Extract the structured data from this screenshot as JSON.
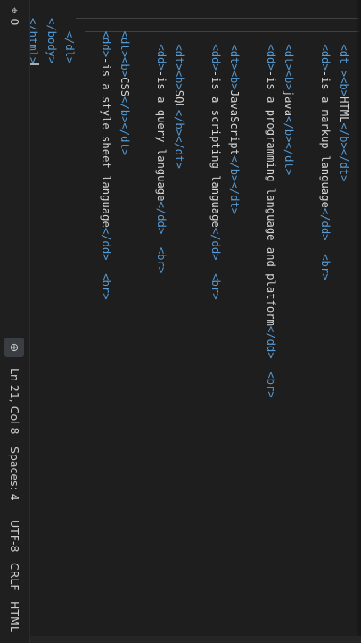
{
  "editor": {
    "lines": [
      [
        [
          "text",
          "    "
        ],
        [
          "tag",
          "<dt "
        ],
        [
          "tag",
          ">"
        ],
        [
          "tag",
          "<b>"
        ],
        [
          "text",
          "HTML"
        ],
        [
          "tag",
          "</b>"
        ],
        [
          "tag",
          "</dt>"
        ]
      ],
      [
        [
          "text",
          "    "
        ],
        [
          "tag",
          "<dd>"
        ],
        [
          "text",
          "-is a markup language"
        ],
        [
          "tag",
          "</dd>"
        ],
        [
          "text",
          "  "
        ],
        [
          "tag",
          "<br>"
        ]
      ],
      [
        [
          "text",
          ""
        ]
      ],
      [
        [
          "text",
          "    "
        ],
        [
          "tag",
          "<dt>"
        ],
        [
          "tag",
          "<b>"
        ],
        [
          "text",
          "java"
        ],
        [
          "tag",
          "</b>"
        ],
        [
          "tag",
          "</dt>"
        ]
      ],
      [
        [
          "text",
          "    "
        ],
        [
          "tag",
          "<dd>"
        ],
        [
          "text",
          "-is a programming language and platform"
        ],
        [
          "tag",
          "</dd>"
        ],
        [
          "text",
          "  "
        ],
        [
          "tag",
          "<br>"
        ]
      ],
      [
        [
          "text",
          ""
        ]
      ],
      [
        [
          "text",
          "    "
        ],
        [
          "tag",
          "<dt>"
        ],
        [
          "tag",
          "<b>"
        ],
        [
          "text",
          "JavaScript"
        ],
        [
          "tag",
          "</b>"
        ],
        [
          "tag",
          "</dt>"
        ]
      ],
      [
        [
          "text",
          "    "
        ],
        [
          "tag",
          "<dd>"
        ],
        [
          "text",
          "-is a scripting language"
        ],
        [
          "tag",
          "</dd>"
        ],
        [
          "text",
          "  "
        ],
        [
          "tag",
          "<br>"
        ]
      ],
      [
        [
          "text",
          ""
        ]
      ],
      [
        [
          "text",
          "    "
        ],
        [
          "tag",
          "<dt>"
        ],
        [
          "tag",
          "<b>"
        ],
        [
          "text",
          "SQL"
        ],
        [
          "tag",
          "</b>"
        ],
        [
          "tag",
          "</dt>"
        ]
      ],
      [
        [
          "text",
          "    "
        ],
        [
          "tag",
          "<dd>"
        ],
        [
          "text",
          "-is a query language"
        ],
        [
          "tag",
          "</dd>"
        ],
        [
          "text",
          "  "
        ],
        [
          "tag",
          "<br>"
        ]
      ],
      [
        [
          "text",
          ""
        ]
      ],
      [
        [
          "text",
          "  "
        ],
        [
          "tag",
          "<dt>"
        ],
        [
          "tag",
          "<b>"
        ],
        [
          "text",
          "CSS"
        ],
        [
          "tag",
          "</b>"
        ],
        [
          "tag",
          "</dt>"
        ]
      ],
      [
        [
          "text",
          "  "
        ],
        [
          "tag",
          "<dd>"
        ],
        [
          "text",
          "-is a style sheet language"
        ],
        [
          "tag",
          "</dd>"
        ],
        [
          "text",
          "  "
        ],
        [
          "tag",
          "<br>"
        ]
      ],
      [
        [
          "text",
          ""
        ]
      ],
      [
        [
          "text",
          "  "
        ],
        [
          "tag",
          "</dl>"
        ]
      ],
      [
        [
          "tag",
          "</body>"
        ]
      ],
      [
        [
          "tag",
          "</html>"
        ],
        [
          "cursor",
          ""
        ]
      ]
    ]
  },
  "status_bar": {
    "ports_icon": "radio-tower-icon",
    "ports_glyph": "⌖",
    "ports_count": "0",
    "zoom_icon": "zoom-in-icon",
    "zoom_glyph": "⊕",
    "position": "Ln 21, Col 8",
    "spaces": "Spaces: 4",
    "encoding": "UTF-8",
    "eol": "CRLF",
    "language": "HTML"
  },
  "colors": {
    "background": "#1e1e1e",
    "tag": "#569cd6",
    "text": "#d4d4d4",
    "status_text": "#cccccc"
  }
}
